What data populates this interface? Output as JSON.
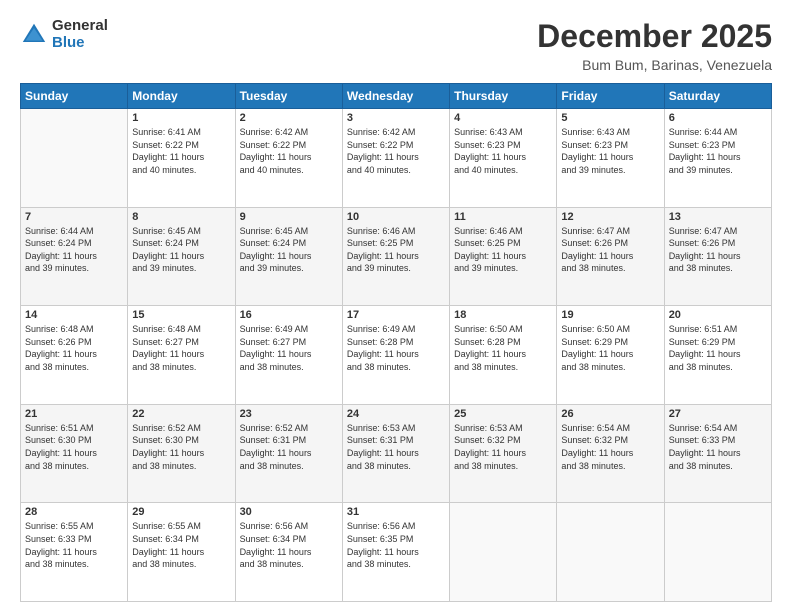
{
  "logo": {
    "general": "General",
    "blue": "Blue"
  },
  "header": {
    "title": "December 2025",
    "subtitle": "Bum Bum, Barinas, Venezuela"
  },
  "days_of_week": [
    "Sunday",
    "Monday",
    "Tuesday",
    "Wednesday",
    "Thursday",
    "Friday",
    "Saturday"
  ],
  "weeks": [
    [
      {
        "num": "",
        "info": ""
      },
      {
        "num": "1",
        "info": "Sunrise: 6:41 AM\nSunset: 6:22 PM\nDaylight: 11 hours\nand 40 minutes."
      },
      {
        "num": "2",
        "info": "Sunrise: 6:42 AM\nSunset: 6:22 PM\nDaylight: 11 hours\nand 40 minutes."
      },
      {
        "num": "3",
        "info": "Sunrise: 6:42 AM\nSunset: 6:22 PM\nDaylight: 11 hours\nand 40 minutes."
      },
      {
        "num": "4",
        "info": "Sunrise: 6:43 AM\nSunset: 6:23 PM\nDaylight: 11 hours\nand 40 minutes."
      },
      {
        "num": "5",
        "info": "Sunrise: 6:43 AM\nSunset: 6:23 PM\nDaylight: 11 hours\nand 39 minutes."
      },
      {
        "num": "6",
        "info": "Sunrise: 6:44 AM\nSunset: 6:23 PM\nDaylight: 11 hours\nand 39 minutes."
      }
    ],
    [
      {
        "num": "7",
        "info": "Sunrise: 6:44 AM\nSunset: 6:24 PM\nDaylight: 11 hours\nand 39 minutes."
      },
      {
        "num": "8",
        "info": "Sunrise: 6:45 AM\nSunset: 6:24 PM\nDaylight: 11 hours\nand 39 minutes."
      },
      {
        "num": "9",
        "info": "Sunrise: 6:45 AM\nSunset: 6:24 PM\nDaylight: 11 hours\nand 39 minutes."
      },
      {
        "num": "10",
        "info": "Sunrise: 6:46 AM\nSunset: 6:25 PM\nDaylight: 11 hours\nand 39 minutes."
      },
      {
        "num": "11",
        "info": "Sunrise: 6:46 AM\nSunset: 6:25 PM\nDaylight: 11 hours\nand 39 minutes."
      },
      {
        "num": "12",
        "info": "Sunrise: 6:47 AM\nSunset: 6:26 PM\nDaylight: 11 hours\nand 38 minutes."
      },
      {
        "num": "13",
        "info": "Sunrise: 6:47 AM\nSunset: 6:26 PM\nDaylight: 11 hours\nand 38 minutes."
      }
    ],
    [
      {
        "num": "14",
        "info": "Sunrise: 6:48 AM\nSunset: 6:26 PM\nDaylight: 11 hours\nand 38 minutes."
      },
      {
        "num": "15",
        "info": "Sunrise: 6:48 AM\nSunset: 6:27 PM\nDaylight: 11 hours\nand 38 minutes."
      },
      {
        "num": "16",
        "info": "Sunrise: 6:49 AM\nSunset: 6:27 PM\nDaylight: 11 hours\nand 38 minutes."
      },
      {
        "num": "17",
        "info": "Sunrise: 6:49 AM\nSunset: 6:28 PM\nDaylight: 11 hours\nand 38 minutes."
      },
      {
        "num": "18",
        "info": "Sunrise: 6:50 AM\nSunset: 6:28 PM\nDaylight: 11 hours\nand 38 minutes."
      },
      {
        "num": "19",
        "info": "Sunrise: 6:50 AM\nSunset: 6:29 PM\nDaylight: 11 hours\nand 38 minutes."
      },
      {
        "num": "20",
        "info": "Sunrise: 6:51 AM\nSunset: 6:29 PM\nDaylight: 11 hours\nand 38 minutes."
      }
    ],
    [
      {
        "num": "21",
        "info": "Sunrise: 6:51 AM\nSunset: 6:30 PM\nDaylight: 11 hours\nand 38 minutes."
      },
      {
        "num": "22",
        "info": "Sunrise: 6:52 AM\nSunset: 6:30 PM\nDaylight: 11 hours\nand 38 minutes."
      },
      {
        "num": "23",
        "info": "Sunrise: 6:52 AM\nSunset: 6:31 PM\nDaylight: 11 hours\nand 38 minutes."
      },
      {
        "num": "24",
        "info": "Sunrise: 6:53 AM\nSunset: 6:31 PM\nDaylight: 11 hours\nand 38 minutes."
      },
      {
        "num": "25",
        "info": "Sunrise: 6:53 AM\nSunset: 6:32 PM\nDaylight: 11 hours\nand 38 minutes."
      },
      {
        "num": "26",
        "info": "Sunrise: 6:54 AM\nSunset: 6:32 PM\nDaylight: 11 hours\nand 38 minutes."
      },
      {
        "num": "27",
        "info": "Sunrise: 6:54 AM\nSunset: 6:33 PM\nDaylight: 11 hours\nand 38 minutes."
      }
    ],
    [
      {
        "num": "28",
        "info": "Sunrise: 6:55 AM\nSunset: 6:33 PM\nDaylight: 11 hours\nand 38 minutes."
      },
      {
        "num": "29",
        "info": "Sunrise: 6:55 AM\nSunset: 6:34 PM\nDaylight: 11 hours\nand 38 minutes."
      },
      {
        "num": "30",
        "info": "Sunrise: 6:56 AM\nSunset: 6:34 PM\nDaylight: 11 hours\nand 38 minutes."
      },
      {
        "num": "31",
        "info": "Sunrise: 6:56 AM\nSunset: 6:35 PM\nDaylight: 11 hours\nand 38 minutes."
      },
      {
        "num": "",
        "info": ""
      },
      {
        "num": "",
        "info": ""
      },
      {
        "num": "",
        "info": ""
      }
    ]
  ]
}
